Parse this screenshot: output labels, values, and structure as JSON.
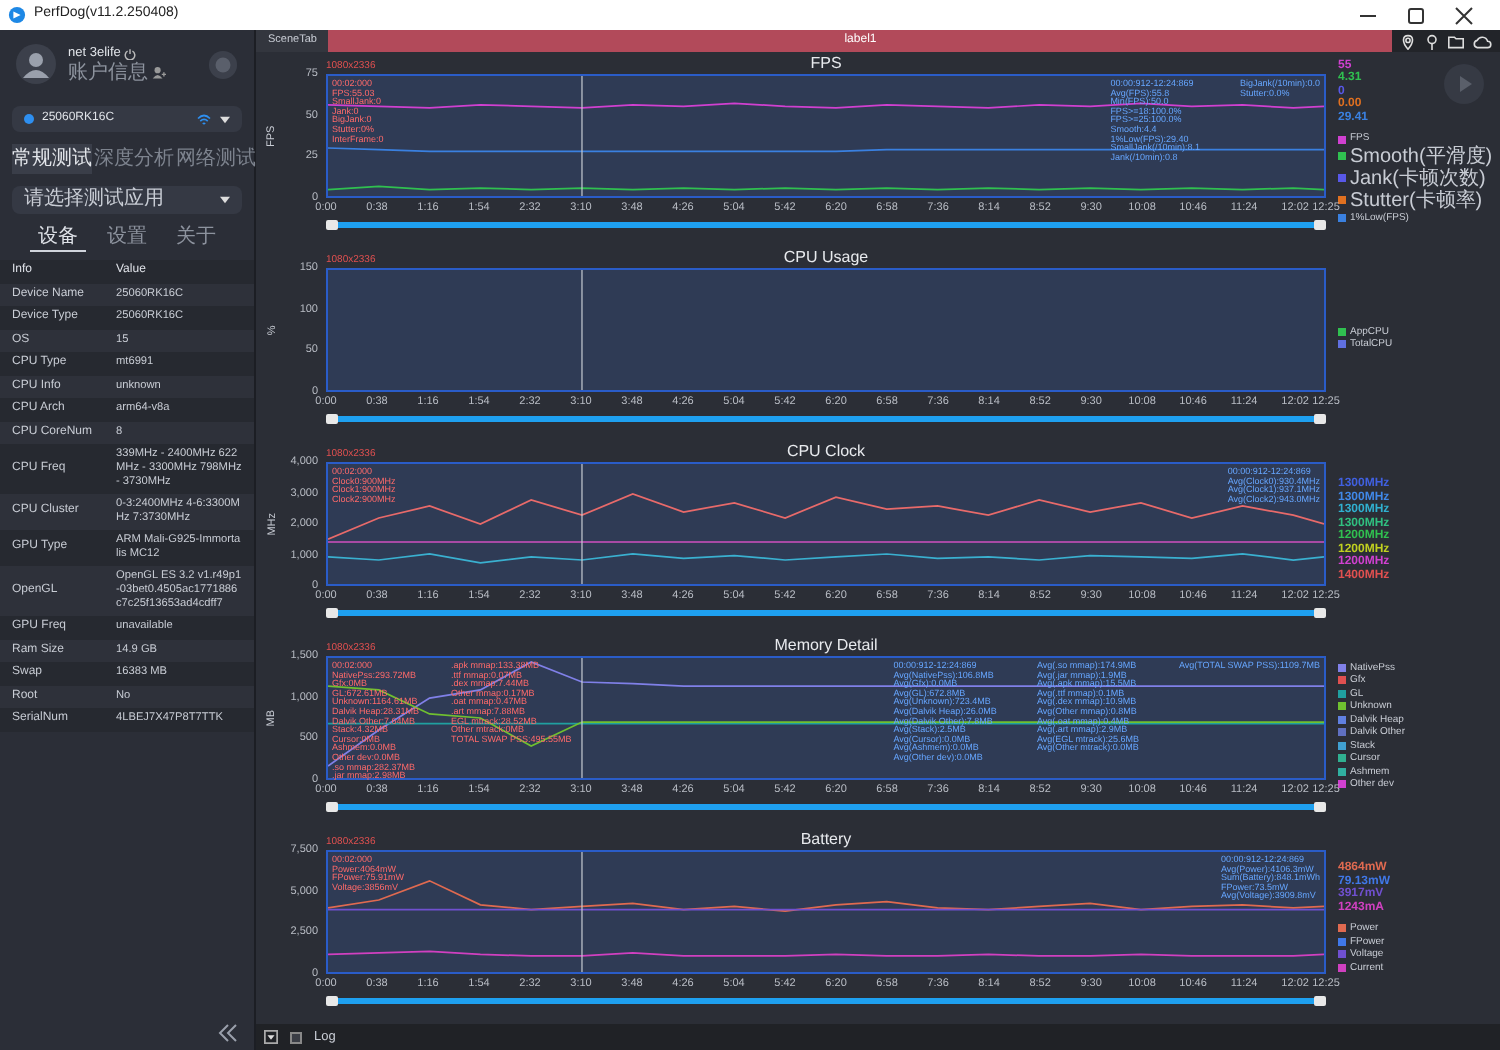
{
  "window": {
    "title": "PerfDog(v11.2.250408)"
  },
  "user": {
    "name": "net 3elife",
    "account": "账户信息"
  },
  "device": {
    "name": "25060RK16C"
  },
  "mode_tabs": [
    {
      "label": "常规测试",
      "selected": true
    },
    {
      "label": "深度分析",
      "selected": false
    },
    {
      "label": "网络测试",
      "selected": false
    }
  ],
  "app_select": {
    "placeholder": "请选择测试应用"
  },
  "info_tabs": [
    {
      "label": "设备",
      "selected": true
    },
    {
      "label": "设置",
      "selected": false
    },
    {
      "label": "关于",
      "selected": false
    }
  ],
  "info_table": {
    "columns": [
      "Info",
      "Value"
    ],
    "rows": [
      [
        "Device Name",
        "25060RK16C"
      ],
      [
        "Device Type",
        "25060RK16C"
      ],
      [
        "OS",
        "15"
      ],
      [
        "CPU Type",
        "mt6991"
      ],
      [
        "CPU Info",
        "unknown"
      ],
      [
        "CPU Arch",
        "arm64-v8a"
      ],
      [
        "CPU CoreNum",
        "8"
      ],
      [
        "CPU Freq",
        "339MHz - 2400MHz 622MHz - 3300MHz 798MHz - 3730MHz"
      ],
      [
        "CPU Cluster",
        "0-3:2400MHz 4-6:3300MHz 7:3730MHz"
      ],
      [
        "GPU Type",
        "ARM Mali-G925-Immortalis MC12"
      ],
      [
        "OpenGL",
        "OpenGL ES 3.2 v1.r49p1-03bet0.4505ac1771886c7c25f13653ad4cdff7"
      ],
      [
        "GPU Freq",
        "unavailable"
      ],
      [
        "Ram Size",
        "14.9 GB"
      ],
      [
        "Swap",
        "16383 MB"
      ],
      [
        "Root",
        "No"
      ],
      [
        "SerialNum",
        "4LBEJ7X47P8T7TTK"
      ]
    ]
  },
  "scene_tab": {
    "label": "SceneTab"
  },
  "label_bar": {
    "label": "label1"
  },
  "charts": [
    {
      "resolution": "1080x2336",
      "left_notes": [
        [
          "00:02:000",
          "FPS:55.03",
          "SmallJank:0",
          "Jank:0",
          "BigJank:0",
          "Stutter:0%",
          "InterFrame:0"
        ]
      ],
      "right_notes": [
        [
          "00:00:912-12:24:869",
          "Avg(FPS):55.8",
          "Min(FPS):50.0",
          "FPS>=18:100.0%",
          "FPS>=25:100.0%",
          "Smooth:4.4",
          "1%Low(FPS):29.40",
          "SmallJank(/10min):8.1",
          "Jank(/10min):0.8"
        ],
        [
          "BigJank(/10min):0.0",
          "Stutter:0.0%"
        ]
      ],
      "readings": [
        {
          "text": "55",
          "color": "#d040d0"
        },
        {
          "text": "4.31",
          "color": "#30c050"
        },
        {
          "text": "0",
          "color": "#5858e8"
        },
        {
          "text": "0.00",
          "color": "#e07020"
        },
        {
          "text": "29.41",
          "color": "#3a80e0"
        }
      ],
      "play_button": true,
      "chart_data": {
        "type": "line",
        "title": "FPS",
        "ylabel": "FPS",
        "xlim": [
          0,
          745
        ],
        "ylim": [
          0,
          75
        ],
        "x": [
          0,
          38,
          76,
          114,
          152,
          190,
          228,
          266,
          304,
          342,
          380,
          418,
          456,
          494,
          532,
          570,
          608,
          646,
          684,
          722,
          745
        ],
        "xticks": [
          {
            "value": 0,
            "label": "0:00"
          },
          {
            "value": 38,
            "label": "0:38"
          },
          {
            "value": 76,
            "label": "1:16"
          },
          {
            "value": 114,
            "label": "1:54"
          },
          {
            "value": 152,
            "label": "2:32"
          },
          {
            "value": 190,
            "label": "3:10"
          },
          {
            "value": 228,
            "label": "3:48"
          },
          {
            "value": 266,
            "label": "4:26"
          },
          {
            "value": 304,
            "label": "5:04"
          },
          {
            "value": 342,
            "label": "5:42"
          },
          {
            "value": 380,
            "label": "6:20"
          },
          {
            "value": 418,
            "label": "6:58"
          },
          {
            "value": 456,
            "label": "7:36"
          },
          {
            "value": 494,
            "label": "8:14"
          },
          {
            "value": 532,
            "label": "8:52"
          },
          {
            "value": 570,
            "label": "9:30"
          },
          {
            "value": 608,
            "label": "10:08"
          },
          {
            "value": 646,
            "label": "10:46"
          },
          {
            "value": 684,
            "label": "11:24"
          },
          {
            "value": 722,
            "label": "12:02"
          },
          {
            "value": 745,
            "label": "12:25"
          }
        ],
        "yticks": [
          0,
          25,
          50,
          75
        ],
        "series": [
          {
            "name": "FPS",
            "color": "#d040d0",
            "values": [
              57,
              56,
              55,
              57,
              56,
              55,
              57,
              56,
              58,
              56,
              55,
              57,
              56,
              55,
              57,
              56,
              58,
              56,
              57,
              55,
              56
            ]
          },
          {
            "name": "Smooth(平滑度)",
            "color": "#30c050",
            "values": [
              4,
              6,
              4,
              5,
              4,
              5,
              4,
              5,
              4,
              5,
              4,
              5,
              4,
              5,
              4,
              5,
              4,
              5,
              4,
              5,
              4
            ]
          },
          {
            "name": "Jank(卡顿次数)",
            "color": "#5858e8",
            "values": [
              null,
              null,
              null,
              null,
              null,
              null,
              null,
              null,
              null,
              null,
              null,
              null,
              null,
              null,
              null,
              null,
              null,
              null,
              null,
              null,
              null
            ]
          },
          {
            "name": "Stutter(卡顿率)",
            "color": "#e07020",
            "values": [
              null,
              null,
              null,
              null,
              null,
              null,
              null,
              null,
              null,
              null,
              null,
              null,
              null,
              null,
              null,
              null,
              null,
              null,
              null,
              null,
              null
            ]
          },
          {
            "name": "1%Low(FPS)",
            "color": "#3a80e0",
            "values": [
              30,
              29,
              28,
              28,
              28,
              28,
              28,
              28,
              28,
              28,
              28,
              29,
              29,
              29,
              29,
              29,
              29,
              29,
              29,
              29,
              29
            ]
          }
        ],
        "legend": "right"
      }
    },
    {
      "resolution": "1080x2336",
      "title": "CPU Usage",
      "ylabel": "%",
      "y_axis_labels": [
        "150",
        "100",
        "50",
        "0"
      ],
      "slider": {
        "level": 1
      },
      "x_axis_labels": [
        "0:00",
        "0:38",
        "1:16",
        "1:54",
        "2:32",
        "3:10",
        "3:48",
        "4:26",
        "5:04",
        "5:42",
        "6:20",
        "6:58",
        "7:36",
        "8:14",
        "8:52",
        "9:30",
        "10:08",
        "10:46",
        "11:24",
        "12:02",
        "12:25"
      ],
      "legend": [
        {
          "label": "AppCPU",
          "color": "#30c050"
        },
        {
          "label": "TotalCPU",
          "color": "#6070e0"
        }
      ]
    },
    {
      "resolution": "1080x2336",
      "left_notes": [
        [
          "00:02:000",
          "Clock0:900MHz",
          "Clock1:900MHz",
          "Clock2:900MHz"
        ]
      ],
      "right_notes": [
        [
          "00:00:912-12:24:869",
          "Avg(Clock0):930.4MHz",
          "Avg(Clock1):937.1MHz",
          "Avg(Clock2):943.0MHz"
        ]
      ],
      "readings": [
        {
          "text": "1300MHz",
          "color": "#4060e0"
        },
        {
          "text": "1300MHz",
          "color": "#4088e8"
        },
        {
          "text": "1300MHz",
          "color": "#30b0d0"
        },
        {
          "text": "1300MHz",
          "color": "#30c080"
        },
        {
          "text": "1200MHz",
          "color": "#30c050"
        },
        {
          "text": "1200MHz",
          "color": "#c0d020"
        },
        {
          "text": "1200MHz",
          "color": "#d040d0"
        },
        {
          "text": "1400MHz",
          "color": "#e05050"
        }
      ],
      "chart_data": {
        "type": "line",
        "title": "CPU Clock",
        "ylabel": "MHz",
        "xlim": [
          0,
          745
        ],
        "ylim": [
          0,
          4000
        ],
        "x": [
          0,
          38,
          76,
          114,
          152,
          190,
          228,
          266,
          304,
          342,
          380,
          418,
          456,
          494,
          532,
          570,
          608,
          646,
          684,
          722,
          745
        ],
        "xticks": [
          {
            "value": 0,
            "label": "0:00"
          },
          {
            "value": 38,
            "label": "0:38"
          },
          {
            "value": 76,
            "label": "1:16"
          },
          {
            "value": 114,
            "label": "1:54"
          },
          {
            "value": 152,
            "label": "2:32"
          },
          {
            "value": 190,
            "label": "3:10"
          },
          {
            "value": 228,
            "label": "3:48"
          },
          {
            "value": 266,
            "label": "4:26"
          },
          {
            "value": 304,
            "label": "5:04"
          },
          {
            "value": 342,
            "label": "5:42"
          },
          {
            "value": 380,
            "label": "6:20"
          },
          {
            "value": 418,
            "label": "6:58"
          },
          {
            "value": 456,
            "label": "7:36"
          },
          {
            "value": 494,
            "label": "8:14"
          },
          {
            "value": 532,
            "label": "8:52"
          },
          {
            "value": 570,
            "label": "9:30"
          },
          {
            "value": 608,
            "label": "10:08"
          },
          {
            "value": 646,
            "label": "10:46"
          },
          {
            "value": 684,
            "label": "11:24"
          },
          {
            "value": 722,
            "label": "12:02"
          },
          {
            "value": 745,
            "label": "12:25"
          }
        ],
        "yticks": [
          0,
          {
            "value": 1000,
            "label": "1,000"
          },
          {
            "value": 2000,
            "label": "2,000"
          },
          {
            "value": 3000,
            "label": "3,000"
          },
          {
            "value": 4000,
            "label": "4,000"
          }
        ],
        "series": [
          {
            "color": "#e86a6a",
            "values": [
              1500,
              2200,
              2600,
              2000,
              2800,
              2300,
              3000,
              2400,
              2700,
              2200,
              2900,
              2500,
              2600,
              2300,
              2800,
              2400,
              2700,
              2200,
              2600,
              2300,
              2000
            ]
          },
          {
            "color": "#3ab0d0",
            "values": [
              900,
              800,
              1000,
              700,
              900,
              800,
              1000,
              850,
              950,
              800,
              900,
              1000,
              850,
              900,
              800,
              950,
              900,
              850,
              1000,
              800,
              900
            ]
          },
          {
            "color": "#d050c0",
            "values": [
              1400,
              1400,
              1400,
              1400,
              1400,
              1400,
              1400,
              1400,
              1400,
              1400,
              1400,
              1400,
              1400,
              1400,
              1400,
              1400,
              1400,
              1400,
              1400,
              1400,
              1400
            ]
          }
        ]
      }
    },
    {
      "resolution": "1080x2336",
      "left_notes": [
        [
          "00:02:000",
          "NativePss:293.72MB",
          "Gfx:0MB",
          "GL:672.61MB",
          "Unknown:1164.61MB",
          "Dalvik Heap:28.31MB",
          "Dalvik Other:7.64MB",
          "Stack:4.32MB",
          "Cursor:0MB",
          "Ashmem:0.0MB",
          "Other dev:0.0MB",
          ".so mmap:282.37MB",
          ".jar mmap:2.98MB"
        ],
        [
          ".apk mmap:133.38MB",
          ".ttf mmap:0.07MB",
          ".dex mmap:7.44MB",
          "Other mmap:0.17MB",
          ".oat mmap:0.47MB",
          ".art mmap:7.88MB",
          "EGL mtrack:28.52MB",
          "Other mtrack:0MB",
          "TOTAL SWAP PSS:495.55MB"
        ]
      ],
      "right_notes": [
        [
          "00:00:912-12:24:869",
          "Avg(NativePss):106.8MB",
          "Avg(Gfx):0.0MB",
          "Avg(GL):672.8MB",
          "Avg(Unknown):723.4MB",
          "Avg(Dalvik Heap):26.0MB",
          "Avg(Dalvik Other):7.8MB",
          "Avg(Stack):2.5MB",
          "Avg(Cursor):0.0MB",
          "Avg(Ashmem):0.0MB",
          "Avg(Other dev):0.0MB"
        ],
        [
          "Avg(.so mmap):174.9MB",
          "Avg(.jar mmap):1.9MB",
          "Avg(.apk mmap):15.5MB",
          "Avg(.ttf mmap):0.1MB",
          "Avg(.dex mmap):10.9MB",
          "Avg(Other mmap):0.8MB",
          "Avg(.oat mmap):0.4MB",
          "Avg(.art mmap):2.9MB",
          "Avg(EGL mtrack):25.6MB",
          "Avg(Other mtrack):0.0MB"
        ],
        [
          "Avg(TOTAL SWAP PSS):1109.7MB"
        ]
      ],
      "chart_data": {
        "type": "line",
        "title": "Memory Detail",
        "ylabel": "MB",
        "xlim": [
          0,
          745
        ],
        "ylim": [
          0,
          1500
        ],
        "x": [
          0,
          38,
          76,
          114,
          152,
          190,
          228,
          266,
          304,
          342,
          380,
          418,
          456,
          494,
          532,
          570,
          608,
          646,
          684,
          722,
          745
        ],
        "xticks": [
          {
            "value": 0,
            "label": "0:00"
          },
          {
            "value": 38,
            "label": "0:38"
          },
          {
            "value": 76,
            "label": "1:16"
          },
          {
            "value": 114,
            "label": "1:54"
          },
          {
            "value": 152,
            "label": "2:32"
          },
          {
            "value": 190,
            "label": "3:10"
          },
          {
            "value": 228,
            "label": "3:48"
          },
          {
            "value": 266,
            "label": "4:26"
          },
          {
            "value": 304,
            "label": "5:04"
          },
          {
            "value": 342,
            "label": "5:42"
          },
          {
            "value": 380,
            "label": "6:20"
          },
          {
            "value": 418,
            "label": "6:58"
          },
          {
            "value": 456,
            "label": "7:36"
          },
          {
            "value": 494,
            "label": "8:14"
          },
          {
            "value": 532,
            "label": "8:52"
          },
          {
            "value": 570,
            "label": "9:30"
          },
          {
            "value": 608,
            "label": "10:08"
          },
          {
            "value": 646,
            "label": "10:46"
          },
          {
            "value": 684,
            "label": "11:24"
          },
          {
            "value": 722,
            "label": "12:02"
          },
          {
            "value": 745,
            "label": "12:25"
          }
        ],
        "yticks": [
          0,
          500,
          {
            "value": 1000,
            "label": "1,000"
          },
          {
            "value": 1500,
            "label": "1,500"
          }
        ],
        "series": [
          {
            "name": "NativePss",
            "color": "#8080e8",
            "values": [
              150,
              600,
              1000,
              1100,
              1450,
              1200,
              1180,
              1150,
              1150,
              1150,
              1150,
              1150,
              1150,
              1150,
              1150,
              1150,
              1150,
              1150,
              1150,
              1150,
              1150
            ]
          },
          {
            "name": "Gfx",
            "color": "#e05050",
            "values": [
              null,
              null,
              null,
              null,
              null,
              null,
              null,
              null,
              null,
              null,
              null,
              null,
              null,
              null,
              null,
              null,
              null,
              null,
              null,
              null,
              null
            ]
          },
          {
            "name": "GL",
            "color": "#20a0a0",
            "values": [
              680,
              680,
              680,
              680,
              680,
              680,
              680,
              680,
              680,
              680,
              680,
              680,
              680,
              680,
              680,
              680,
              680,
              680,
              680,
              680,
              680
            ]
          },
          {
            "name": "Unknown",
            "color": "#70c030",
            "values": [
              1150,
              1100,
              800,
              750,
              400,
              700,
              700,
              700,
              700,
              700,
              700,
              700,
              700,
              700,
              700,
              700,
              700,
              700,
              700,
              700,
              700
            ]
          },
          {
            "name": "Dalvik Heap",
            "color": "#6080e0",
            "values": [
              null,
              null,
              null,
              null,
              null,
              null,
              null,
              null,
              null,
              null,
              null,
              null,
              null,
              null,
              null,
              null,
              null,
              null,
              null,
              null,
              null
            ]
          },
          {
            "name": "Dalvik Other",
            "color": "#6070c0",
            "values": [
              null,
              null,
              null,
              null,
              null,
              null,
              null,
              null,
              null,
              null,
              null,
              null,
              null,
              null,
              null,
              null,
              null,
              null,
              null,
              null,
              null
            ]
          },
          {
            "name": "Stack",
            "color": "#40a0d0",
            "values": [
              null,
              null,
              null,
              null,
              null,
              null,
              null,
              null,
              null,
              null,
              null,
              null,
              null,
              null,
              null,
              null,
              null,
              null,
              null,
              null,
              null
            ]
          },
          {
            "name": "Cursor",
            "color": "#30b090",
            "values": [
              null,
              null,
              null,
              null,
              null,
              null,
              null,
              null,
              null,
              null,
              null,
              null,
              null,
              null,
              null,
              null,
              null,
              null,
              null,
              null,
              null
            ]
          },
          {
            "name": "Ashmem",
            "color": "#30b0a0",
            "values": [
              null,
              null,
              null,
              null,
              null,
              null,
              null,
              null,
              null,
              null,
              null,
              null,
              null,
              null,
              null,
              null,
              null,
              null,
              null,
              null,
              null
            ]
          },
          {
            "name": "Other dev",
            "color": "#d040d0",
            "values": [
              null,
              null,
              null,
              null,
              null,
              null,
              null,
              null,
              null,
              null,
              null,
              null,
              null,
              null,
              null,
              null,
              null,
              null,
              null,
              null,
              null
            ]
          }
        ],
        "legend": "right"
      }
    },
    {
      "resolution": "1080x2336",
      "left_notes": [
        [
          "00:02:000",
          "Power:4064mW",
          "FPower:75.91mW",
          "Voltage:3856mV"
        ]
      ],
      "right_notes": [
        [
          "00:00:912-12:24:869",
          "Avg(Power):4106.3mW",
          "Sum(Battery):848.1mWh",
          "FPower:73.5mW",
          "Avg(Voltage):3909.8mV"
        ]
      ],
      "readings": [
        {
          "text": "4864mW",
          "color": "#e06a50"
        },
        {
          "text": "79.13mW",
          "color": "#4078e8"
        },
        {
          "text": "3917mV",
          "color": "#7050d0"
        },
        {
          "text": "1243mA",
          "color": "#d040c0"
        }
      ],
      "chart_data": {
        "type": "line",
        "title": "Battery",
        "xlim": [
          0,
          745
        ],
        "ylim": [
          0,
          7500
        ],
        "x": [
          0,
          38,
          76,
          114,
          152,
          190,
          228,
          266,
          304,
          342,
          380,
          418,
          456,
          494,
          532,
          570,
          608,
          646,
          684,
          722,
          745
        ],
        "xticks": [
          {
            "value": 0,
            "label": "0:00"
          },
          {
            "value": 38,
            "label": "0:38"
          },
          {
            "value": 76,
            "label": "1:16"
          },
          {
            "value": 114,
            "label": "1:54"
          },
          {
            "value": 152,
            "label": "2:32"
          },
          {
            "value": 190,
            "label": "3:10"
          },
          {
            "value": 228,
            "label": "3:48"
          },
          {
            "value": 266,
            "label": "4:26"
          },
          {
            "value": 304,
            "label": "5:04"
          },
          {
            "value": 342,
            "label": "5:42"
          },
          {
            "value": 380,
            "label": "6:20"
          },
          {
            "value": 418,
            "label": "6:58"
          },
          {
            "value": 456,
            "label": "7:36"
          },
          {
            "value": 494,
            "label": "8:14"
          },
          {
            "value": 532,
            "label": "8:52"
          },
          {
            "value": 570,
            "label": "9:30"
          },
          {
            "value": 608,
            "label": "10:08"
          },
          {
            "value": 646,
            "label": "10:46"
          },
          {
            "value": 684,
            "label": "11:24"
          },
          {
            "value": 722,
            "label": "12:02"
          },
          {
            "value": 745,
            "label": "12:25"
          }
        ],
        "yticks": [
          0,
          {
            "value": 2500,
            "label": "2,500"
          },
          {
            "value": 5000,
            "label": "5,000"
          },
          {
            "value": 7500,
            "label": "7,500"
          }
        ],
        "series": [
          {
            "name": "Power",
            "color": "#e06a50",
            "values": [
              4000,
              4500,
              5700,
              4200,
              3900,
              4100,
              4300,
              3900,
              4100,
              3800,
              4200,
              4400,
              4000,
              3900,
              4100,
              4300,
              3900,
              4100,
              4200,
              4000,
              4100
            ]
          },
          {
            "name": "FPower",
            "color": "#4078e8",
            "values": [
              null,
              null,
              null,
              null,
              null,
              null,
              null,
              null,
              null,
              null,
              null,
              null,
              null,
              null,
              null,
              null,
              null,
              null,
              null,
              null,
              null
            ]
          },
          {
            "name": "Voltage",
            "color": "#7050d0",
            "values": [
              3900,
              3900,
              3900,
              3900,
              3900,
              3900,
              3900,
              3900,
              3900,
              3900,
              3900,
              3900,
              3900,
              3900,
              3900,
              3900,
              3900,
              3900,
              3900,
              3900,
              3900
            ]
          },
          {
            "name": "Current",
            "color": "#d040c0",
            "values": [
              1100,
              1200,
              1300,
              1100,
              1000,
              1000,
              1200,
              1000,
              1000,
              1000,
              1100,
              1000,
              1000,
              1100,
              1000,
              1000,
              1100,
              1000,
              1000,
              1000,
              1100
            ]
          }
        ],
        "legend": "right"
      }
    }
  ],
  "log": {
    "label": "Log",
    "checked": false
  }
}
